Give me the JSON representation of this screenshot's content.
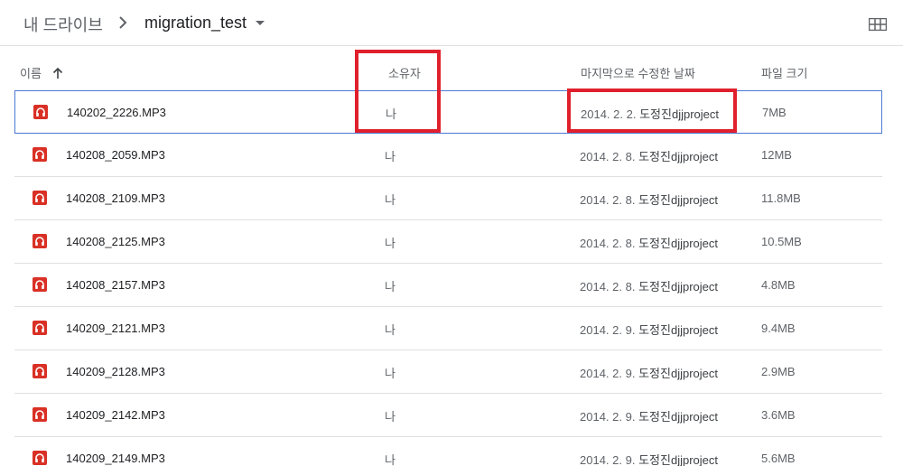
{
  "breadcrumb": {
    "root": "내 드라이브",
    "current": "migration_test"
  },
  "columns": {
    "name": "이름",
    "owner": "소유자",
    "modified": "마지막으로 수정한 날짜",
    "size": "파일 크기"
  },
  "files": [
    {
      "name": "140202_2226.MP3",
      "owner": "나",
      "modified_date": "2014. 2. 2.",
      "modified_by": "도정진djjproject",
      "size": "7MB"
    },
    {
      "name": "140208_2059.MP3",
      "owner": "나",
      "modified_date": "2014. 2. 8.",
      "modified_by": "도정진djjproject",
      "size": "12MB"
    },
    {
      "name": "140208_2109.MP3",
      "owner": "나",
      "modified_date": "2014. 2. 8.",
      "modified_by": "도정진djjproject",
      "size": "11.8MB"
    },
    {
      "name": "140208_2125.MP3",
      "owner": "나",
      "modified_date": "2014. 2. 8.",
      "modified_by": "도정진djjproject",
      "size": "10.5MB"
    },
    {
      "name": "140208_2157.MP3",
      "owner": "나",
      "modified_date": "2014. 2. 8.",
      "modified_by": "도정진djjproject",
      "size": "4.8MB"
    },
    {
      "name": "140209_2121.MP3",
      "owner": "나",
      "modified_date": "2014. 2. 9.",
      "modified_by": "도정진djjproject",
      "size": "9.4MB"
    },
    {
      "name": "140209_2128.MP3",
      "owner": "나",
      "modified_date": "2014. 2. 9.",
      "modified_by": "도정진djjproject",
      "size": "2.9MB"
    },
    {
      "name": "140209_2142.MP3",
      "owner": "나",
      "modified_date": "2014. 2. 9.",
      "modified_by": "도정진djjproject",
      "size": "3.6MB"
    },
    {
      "name": "140209_2149.MP3",
      "owner": "나",
      "modified_date": "2014. 2. 9.",
      "modified_by": "도정진djjproject",
      "size": "5.6MB"
    }
  ],
  "icons": {
    "breadcrumb_separator": "chevron-right-icon",
    "current_folder_menu": "caret-down-icon",
    "view_toggle": "grid-view-icon",
    "sort": "arrow-up-icon",
    "file_type": "audio-file-icon"
  },
  "colors": {
    "audio_icon": "#d93025",
    "selection_border": "#4a7bd4",
    "highlight_box": "#e0202c"
  }
}
